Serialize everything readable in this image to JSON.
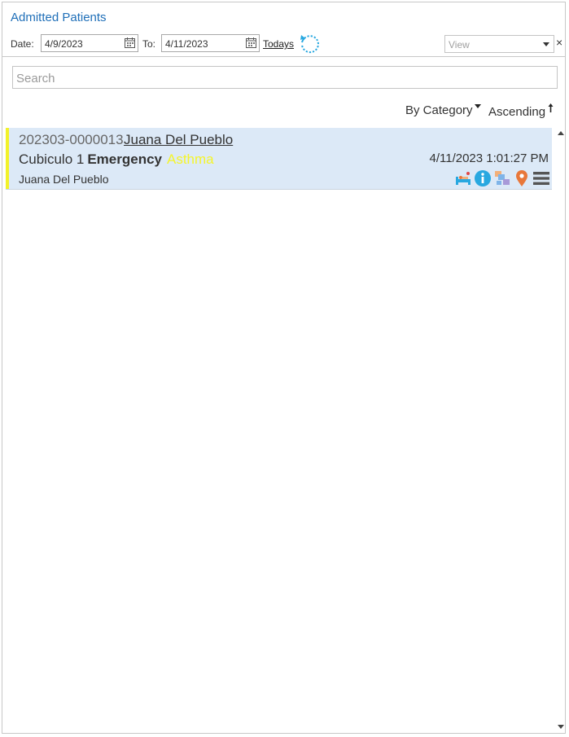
{
  "header": {
    "title": "Admitted Patients"
  },
  "filters": {
    "date_label": "Date:",
    "date_from": "4/9/2023",
    "to_label": "To:",
    "date_to": "4/11/2023",
    "todays_label": "Todays",
    "view_placeholder": "View",
    "clear_glyph": "×"
  },
  "search": {
    "placeholder": "Search"
  },
  "sort": {
    "by": "By Category",
    "order": "Ascending"
  },
  "patients": [
    {
      "id": "202303-0000013",
      "name": "Juana Del Pueblo",
      "location": "Cubiculo 1",
      "department": "Emergency",
      "condition": "Asthma",
      "datetime": "4/11/2023 1:01:27 PM",
      "subname": "Juana Del Pueblo",
      "icons": [
        "bed-icon",
        "info-icon",
        "transfer-icon",
        "location-pin-icon",
        "menu-icon"
      ]
    }
  ],
  "colors": {
    "title": "#1f6fb8",
    "card_bg": "#dce9f7",
    "accent": "#f2f22a",
    "condition": "#f5f52a",
    "info": "#29a8e0",
    "pin": "#e8773a"
  }
}
